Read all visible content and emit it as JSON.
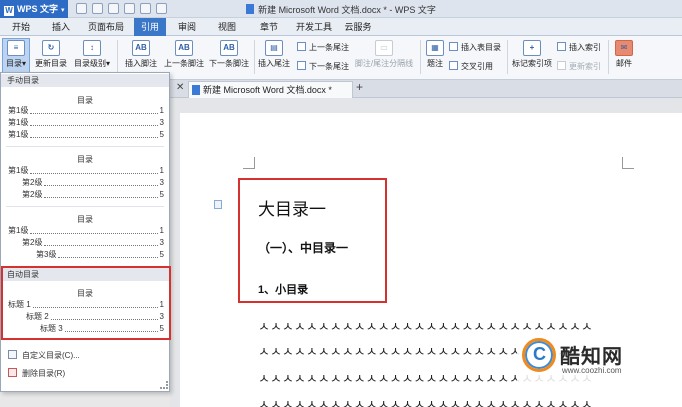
{
  "app": {
    "name": "WPS 文字",
    "window_title": "新建 Microsoft Word 文档.docx * - WPS 文字"
  },
  "menu": [
    "开始",
    "插入",
    "页面布局",
    "引用",
    "审阅",
    "视图",
    "章节",
    "开发工具",
    "云服务"
  ],
  "menu_active": "引用",
  "ribbon": {
    "toc": "目录",
    "update_toc": "更新目录",
    "toc_level": "目录级别",
    "insert_footnote": "插入脚注",
    "prev_footnote": "上一条脚注",
    "next_footnote": "下一条脚注",
    "insert_endnote": "插入尾注",
    "prev_endnote": "上一条尾注",
    "next_endnote": "下一条尾注",
    "note_separator": "脚注/尾注分隔线",
    "caption": "题注",
    "insert_table_toc": "插入表目录",
    "cross_ref": "交叉引用",
    "mark_index": "标记索引项",
    "insert_index": "插入索引",
    "update_index": "更新索引",
    "mail": "邮件"
  },
  "doc_tab": "新建 Microsoft Word 文档.docx *",
  "toc_panel": {
    "manual_header": "手动目录",
    "auto_header": "自动目录",
    "preview_title": "目录",
    "manual_1": [
      {
        "label": "第1级",
        "page": "1"
      },
      {
        "label": "第1级",
        "page": "3"
      },
      {
        "label": "第1级",
        "page": "5"
      }
    ],
    "manual_2": [
      {
        "label": "第1级",
        "page": "1"
      },
      {
        "label": "第2级",
        "page": "3"
      },
      {
        "label": "第2级",
        "page": "5"
      }
    ],
    "manual_3": [
      {
        "label": "第1级",
        "page": "1"
      },
      {
        "label": "第2级",
        "page": "3"
      },
      {
        "label": "第3级",
        "page": "5"
      }
    ],
    "auto": [
      {
        "label": "标题 1",
        "page": "1"
      },
      {
        "label": "标题 2",
        "page": "3"
      },
      {
        "label": "标题 3",
        "page": "5"
      }
    ],
    "custom_action": "自定义目录(C)...",
    "delete_action": "删除目录(R)"
  },
  "document": {
    "h1": "大目录一",
    "h2": "（一）、中目录一",
    "h3": "1、小目录",
    "body_line": "ㅅㅅㅅㅅㅅㅅㅅㅅㅅㅅㅅㅅㅅㅅㅅㅅㅅㅅㅅㅅㅅㅅㅅㅅㅅㅅㅅㅅ"
  },
  "watermark": {
    "logo_letter": "C",
    "name": "酷知网",
    "url": "www.coozhi.com"
  }
}
